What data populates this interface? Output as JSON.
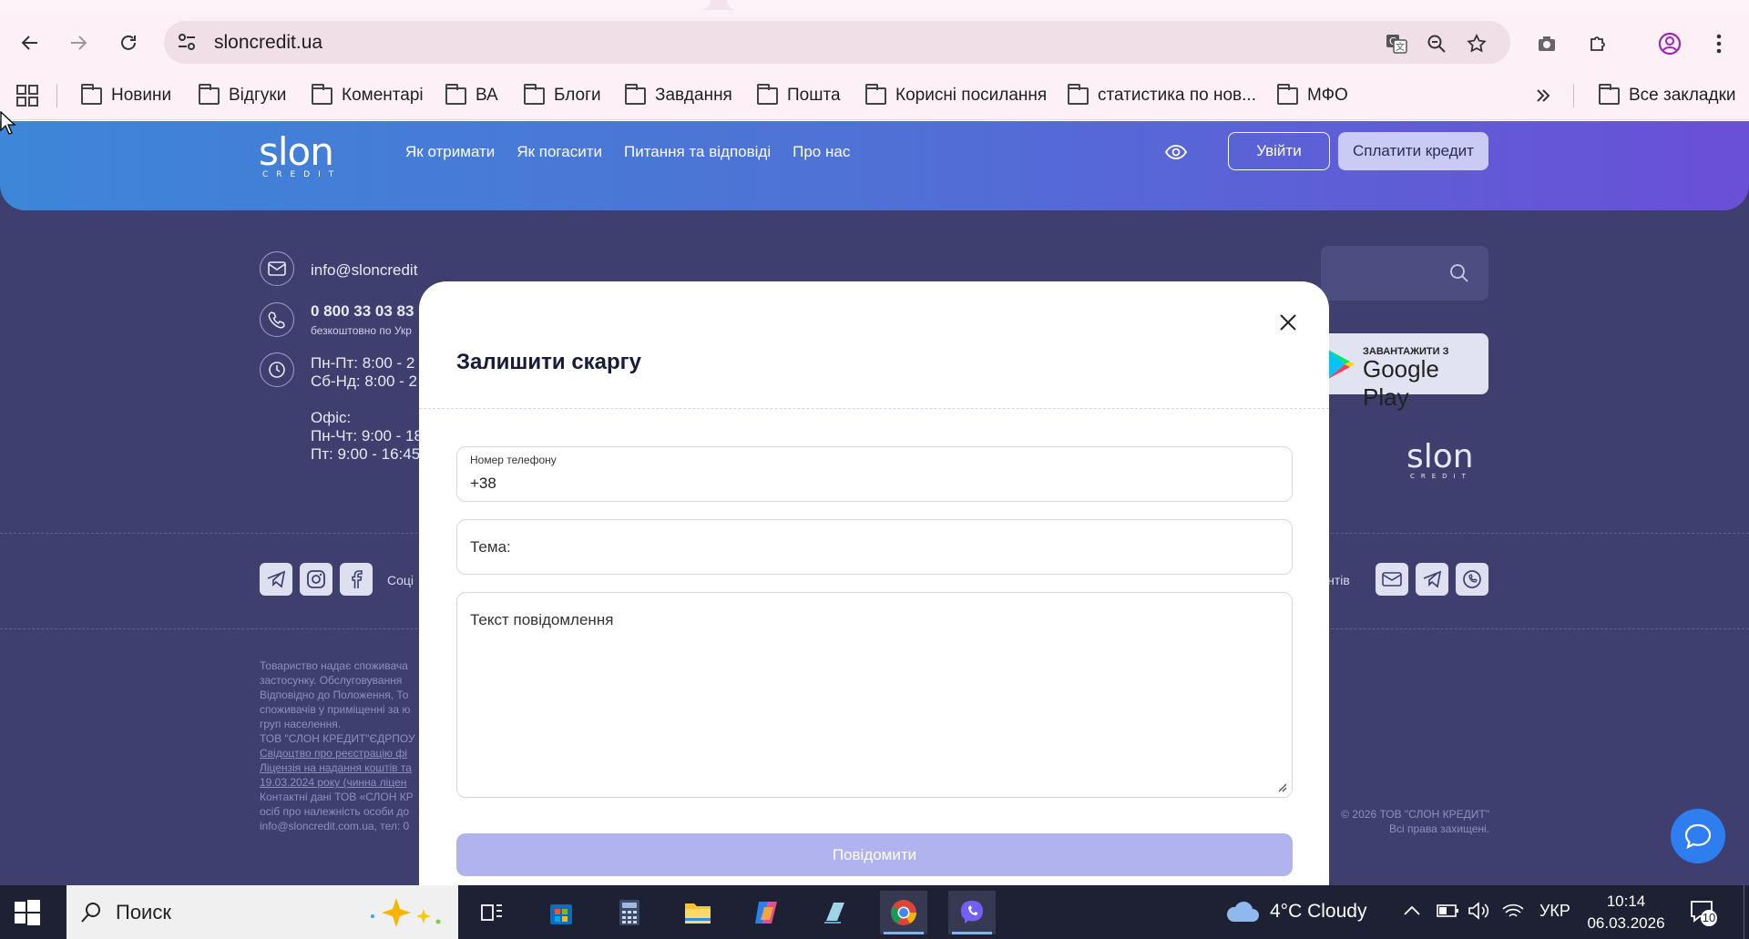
{
  "browser": {
    "url": "sloncredit.ua",
    "bookmarks": [
      "Новини",
      "Відгуки",
      "Коментарі",
      "ВА",
      "Блоги",
      "Завдання",
      "Пошта",
      "Корисні посилання",
      "статистика по нов...",
      "МФО"
    ],
    "all_bookmarks": "Все закладки"
  },
  "site": {
    "logo": "slon",
    "logo_sub": "CREDIT",
    "nav": [
      "Як отримати",
      "Як погасити",
      "Питання та відповіді",
      "Про нас"
    ],
    "login": "Увійти",
    "pay": "Сплатити кредит",
    "email": "info@sloncredit",
    "phone": "0 800 33 03 83",
    "phone_note": "безкоштовно по Укр",
    "hours_1": "Пн-Пт: 8:00 - 2",
    "hours_2": "Сб-Нд: 8:00 - 2",
    "office_label": "Офіс:",
    "office_1": "Пн-Чт: 9:00 - 18",
    "office_2": "Пт: 9:00 - 16:45",
    "gplay_small": "ЗАВАНТАЖИТИ З",
    "gplay_big": "Google Play",
    "social_label": "Соці",
    "support_label": "єнтів",
    "fineprint": [
      "Товариство надає споживача",
      "застосунку. Обслуговування",
      "Відповідно до Положення, То",
      "споживачів у приміщенні за ю",
      "груп населення.",
      "ТОВ \"СЛОН КРЕДИТ\"ЄДРПОУ",
      "Свідоцтво про реєстрацію фі",
      "Ліцензія на надання коштів та",
      "19.03.2024 року (чинна ліцен",
      "Контактні дані ТОВ «СЛОН КР",
      "осіб про належність особи до",
      "info@sloncredit.com.ua, тел: 0"
    ],
    "copyright_1": "© 2026 ТОВ \"СЛОН КРЕДИТ\"",
    "copyright_2": "Всі права захищені."
  },
  "modal": {
    "title": "Залишити скаргу",
    "phone_label": "Номер телефону",
    "phone_value": "+38",
    "subject_placeholder": "Тема:",
    "message_placeholder": "Текст повідомлення",
    "submit": "Повідомити"
  },
  "taskbar": {
    "search": "Поиск",
    "weather": "4°C  Cloudy",
    "lang": "УКР",
    "time": "10:14",
    "date": "06.03.2026",
    "notifications": "10"
  }
}
